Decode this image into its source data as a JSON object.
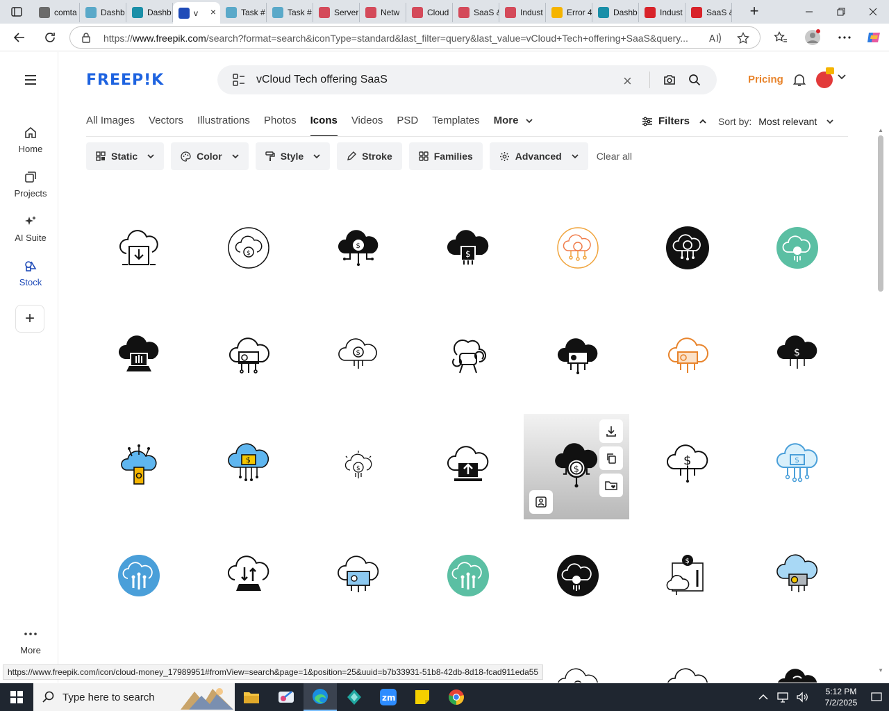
{
  "browser": {
    "tabs": [
      {
        "label": "comta",
        "fav_color": "#6b6b6b"
      },
      {
        "label": "Dashb",
        "fav_color": "#5aa9c9"
      },
      {
        "label": "Dashb",
        "fav_color": "#1a8fa8"
      },
      {
        "label": "v",
        "fav_color": "#1f4bb8",
        "active": true
      },
      {
        "label": "Task #",
        "fav_color": "#5aa9c9"
      },
      {
        "label": "Task #",
        "fav_color": "#5aa9c9"
      },
      {
        "label": "Server",
        "fav_color": "#d44a5a"
      },
      {
        "label": "Netw",
        "fav_color": "#d44a5a"
      },
      {
        "label": "Cloud",
        "fav_color": "#d44a5a"
      },
      {
        "label": "SaaS &",
        "fav_color": "#d44a5a"
      },
      {
        "label": "Indust",
        "fav_color": "#d44a5a"
      },
      {
        "label": "Error 4",
        "fav_color": "#f5b400"
      },
      {
        "label": "Dashb",
        "fav_color": "#1a8fa8"
      },
      {
        "label": "Indust",
        "fav_color": "#d8232a"
      },
      {
        "label": "SaaS &",
        "fav_color": "#d8232a"
      }
    ],
    "active_tab_close": "×",
    "new_tab": "+",
    "url_prefix": "https://",
    "url_host": "www.freepik.com",
    "url_rest": "/search?format=search&iconType=standard&last_filter=query&last_value=vCloud+Tech+offering+SaaS&query..."
  },
  "sidebar": {
    "items": [
      {
        "label": "Home"
      },
      {
        "label": "Projects"
      },
      {
        "label": "AI Suite"
      },
      {
        "label": "Stock",
        "active": true
      }
    ],
    "plus": "+",
    "more_label": "More"
  },
  "header": {
    "logo": "FREEP!K",
    "search_value": "vCloud Tech offering SaaS",
    "search_clear": "×",
    "pricing": "Pricing"
  },
  "nav": {
    "items": [
      "All Images",
      "Vectors",
      "Illustrations",
      "Photos",
      "Icons",
      "Videos",
      "PSD",
      "Templates",
      "More"
    ],
    "active": "Icons",
    "filters": "Filters",
    "sort_label": "Sort by:",
    "sort_value": "Most relevant"
  },
  "chips": {
    "items": [
      "Static",
      "Color",
      "Style",
      "Stroke",
      "Families",
      "Advanced"
    ],
    "clear_all": "Clear all"
  },
  "status_url": "https://www.freepik.com/icon/cloud-money_17989951#fromView=search&page=1&position=25&uuid=b7b33931-51b8-42db-8d18-fcad911eda55",
  "taskbar": {
    "search_placeholder": "Type here to search",
    "time": "5:12 PM",
    "date": "7/2/2025"
  },
  "colors": {
    "brand_blue": "#1e63e0",
    "pricing_orange": "#e8842c",
    "accent_teal": "#5bbfa3",
    "accent_sky": "#4a9fd9"
  }
}
